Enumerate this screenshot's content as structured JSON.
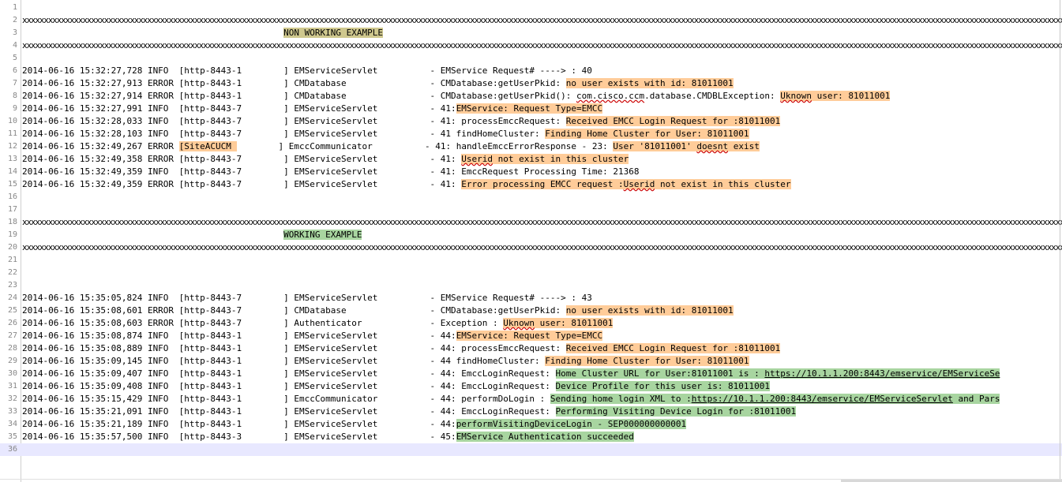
{
  "editor": {
    "lines": [
      {
        "n": "1",
        "segs": []
      },
      {
        "n": "2",
        "sep": true,
        "segs": [
          {
            "t": "xxxxxxxxxxxxxxxxxxxxxxxxxxxxxxxxxxxxxxxxxxxxxxxxxxxxxxxxxxxxxxxxxxxxxxxxxxxxxxxxxxxxxxxxxxxxxxxxxxxxxxxxxxxxxxxxxxxxxxxxxxxxxxxxxxxxxxxxxxxxxxxxxxxxxxxxxxxxxxxxxxxxxxxxxxxxxxxxxxxxxxxxxxxxxxxxxxxxxxxxxxxxxxxxxxxxxxxxxxxxxxxxxxxxxxxxxxxxxxxxxxxxxxxxxxxxxxxxxxxxxxxxxxxxxxxxxxxxxxxxxxxxxxxxxxxxxxxxxxxxxxxxxxxxxxxxxxxxxxxxxx"
          }
        ]
      },
      {
        "n": "3",
        "segs": [
          {
            "t": "                                                  "
          },
          {
            "t": "NON WORKING EXAMPLE",
            "c": "t"
          }
        ]
      },
      {
        "n": "4",
        "sep": true,
        "segs": [
          {
            "t": "xxxxxxxxxxxxxxxxxxxxxxxxxxxxxxxxxxxxxxxxxxxxxxxxxxxxxxxxxxxxxxxxxxxxxxxxxxxxxxxxxxxxxxxxxxxxxxxxxxxxxxxxxxxxxxxxxxxxxxxxxxxxxxxxxxxxxxxxxxxxxxxxxxxxxxxxxxxxxxxxxxxxxxxxxxxxxxxxxxxxxxxxxxxxxxxxxxxxxxxxxxxxxxxxxxxxxxxxxxxxxxxxxxxxxxxxxxxxxxxxxxxxxxxxxxxxxxxxxxxxxxxxxxxxxxxxxxxxxxxxxxxxxxxxxxxxxxxxxxxxxxxxxxxxxxxxxxxxxxxxx"
          }
        ]
      },
      {
        "n": "5",
        "segs": []
      },
      {
        "n": "6",
        "segs": [
          {
            "t": "2014-06-16 15:32:27,728 INFO  [http-8443-1        ] EMServiceServlet          - EMService Request# ----> : 40"
          }
        ]
      },
      {
        "n": "7",
        "segs": [
          {
            "t": "2014-06-16 15:32:27,913 ERROR [http-8443-1        ] CMDatabase                - CMDatabase:getUserPkid: "
          },
          {
            "t": "no user exists with id: 81011001",
            "c": "o"
          }
        ]
      },
      {
        "n": "8",
        "segs": [
          {
            "t": "2014-06-16 15:32:27,914 ERROR [http-8443-1        ] CMDatabase                - CMDatabase:getUserPkid(): "
          },
          {
            "t": "com.cisco.ccm",
            "c": "u"
          },
          {
            "t": ".database.CMDBLException: "
          },
          {
            "t": "Uknown",
            "c": "ou"
          },
          {
            "t": " user: 81011001",
            "c": "o"
          }
        ]
      },
      {
        "n": "9",
        "segs": [
          {
            "t": "2014-06-16 15:32:27,991 INFO  [http-8443-7        ] EMServiceServlet          - 41:"
          },
          {
            "t": "EMService: Request Type=EMCC",
            "c": "o"
          }
        ]
      },
      {
        "n": "10",
        "segs": [
          {
            "t": "2014-06-16 15:32:28,033 INFO  [http-8443-7        ] EMServiceServlet          - 41: processEmccRequest: "
          },
          {
            "t": "Received EMCC Login Request for :81011001",
            "c": "o"
          }
        ]
      },
      {
        "n": "11",
        "segs": [
          {
            "t": "2014-06-16 15:32:28,103 INFO  [http-8443-7        ] EMServiceServlet          - 41 findHomeCluster: "
          },
          {
            "t": "Finding Home Cluster for User: 81011001",
            "c": "o"
          }
        ]
      },
      {
        "n": "12",
        "segs": [
          {
            "t": "2014-06-16 15:32:49,267 ERROR "
          },
          {
            "t": "[SiteACUCM ",
            "c": "o"
          },
          {
            "t": "        ] EmccCommunicator          - 41: handleEmccErrorResponse - 23: "
          },
          {
            "t": "User '81011001' ",
            "c": "o"
          },
          {
            "t": "doesnt",
            "c": "ou"
          },
          {
            "t": " exist",
            "c": "o"
          }
        ]
      },
      {
        "n": "13",
        "segs": [
          {
            "t": "2014-06-16 15:32:49,358 ERROR [http-8443-7        ] EMServiceServlet          - 41: "
          },
          {
            "t": "Userid",
            "c": "ou"
          },
          {
            "t": " not exist in this cluster",
            "c": "o"
          }
        ]
      },
      {
        "n": "14",
        "segs": [
          {
            "t": "2014-06-16 15:32:49,359 INFO  [http-8443-7        ] EMServiceServlet          - 41: EmccRequest Processing Time: 21368"
          }
        ]
      },
      {
        "n": "15",
        "segs": [
          {
            "t": "2014-06-16 15:32:49,359 ERROR [http-8443-7        ] EMServiceServlet          - 41: "
          },
          {
            "t": "Error processing EMCC request :",
            "c": "o"
          },
          {
            "t": "Userid",
            "c": "ou"
          },
          {
            "t": " not exist in this cluster",
            "c": "o"
          }
        ]
      },
      {
        "n": "16",
        "segs": []
      },
      {
        "n": "17",
        "segs": []
      },
      {
        "n": "18",
        "sep": true,
        "segs": [
          {
            "t": "xxxxxxxxxxxxxxxxxxxxxxxxxxxxxxxxxxxxxxxxxxxxxxxxxxxxxxxxxxxxxxxxxxxxxxxxxxxxxxxxxxxxxxxxxxxxxxxxxxxxxxxxxxxxxxxxxxxxxxxxxxxxxxxxxxxxxxxxxxxxxxxxxxxxxxxxxxxxxxxxxxxxxxxxxxxxxxxxxxxxxxxxxxxxxxxxxxxxxxxxxxxxxxxxxxxxxxxxxxxxxxxxxxxxxxxxxxxxxxxxxxxxxxxxxxxxxxxxxxxxxxxxxxxxxxxxxxxxxxxxxxxxxxxxxxxxxxxxxxxxxxxxxxxxxxxxxxxxxxxxx"
          }
        ]
      },
      {
        "n": "19",
        "segs": [
          {
            "t": "                                                  "
          },
          {
            "t": "WORKING EXAMPLE",
            "c": "g"
          }
        ]
      },
      {
        "n": "20",
        "sep": true,
        "segs": [
          {
            "t": "xxxxxxxxxxxxxxxxxxxxxxxxxxxxxxxxxxxxxxxxxxxxxxxxxxxxxxxxxxxxxxxxxxxxxxxxxxxxxxxxxxxxxxxxxxxxxxxxxxxxxxxxxxxxxxxxxxxxxxxxxxxxxxxxxxxxxxxxxxxxxxxxxxxxxxxxxxxxxxxxxxxxxxxxxxxxxxxxxxxxxxxxxxxxxxxxxxxxxxxxxxxxxxxxxxxxxxxxxxxxxxxxxxxxxxxxxxxxxxxxxxxxxxxxxxxxxxxxxxxxxxxxxxxxxxxxxxxxxxxxxxxxxxxxxxxxxxxxxxxxxxxxxxxxxxxxxxxxxxxxxx"
          }
        ]
      },
      {
        "n": "21",
        "segs": []
      },
      {
        "n": "22",
        "segs": []
      },
      {
        "n": "23",
        "segs": []
      },
      {
        "n": "24",
        "segs": [
          {
            "t": "2014-06-16 15:35:05,824 INFO  [http-8443-7        ] EMServiceServlet          - EMService Request# ----> : 43"
          }
        ]
      },
      {
        "n": "25",
        "segs": [
          {
            "t": "2014-06-16 15:35:08,601 ERROR [http-8443-7        ] CMDatabase                - CMDatabase:getUserPkid: "
          },
          {
            "t": "no user exists with id: 81011001",
            "c": "o"
          }
        ]
      },
      {
        "n": "26",
        "segs": [
          {
            "t": "2014-06-16 15:35:08,603 ERROR [http-8443-7        ] Authenticator             - Exception : "
          },
          {
            "t": "Uknown",
            "c": "ou"
          },
          {
            "t": " user: 81011001",
            "c": "o"
          }
        ]
      },
      {
        "n": "27",
        "segs": [
          {
            "t": "2014-06-16 15:35:08,874 INFO  [http-8443-1        ] EMServiceServlet          - 44:"
          },
          {
            "t": "EMService: Request Type=EMCC",
            "c": "o"
          }
        ]
      },
      {
        "n": "28",
        "segs": [
          {
            "t": "2014-06-16 15:35:08,889 INFO  [http-8443-1        ] EMServiceServlet          - 44: processEmccRequest: "
          },
          {
            "t": "Received EMCC Login Request for :81011001",
            "c": "o"
          }
        ]
      },
      {
        "n": "29",
        "segs": [
          {
            "t": "2014-06-16 15:35:09,145 INFO  [http-8443-1        ] EMServiceServlet          - 44 findHomeCluster: "
          },
          {
            "t": "Finding Home Cluster for User: 81011001",
            "c": "o"
          }
        ]
      },
      {
        "n": "30",
        "segs": [
          {
            "t": "2014-06-16 15:35:09,407 INFO  [http-8443-1        ] EMServiceServlet          - 44: EmccLoginRequest: "
          },
          {
            "t": "Home Cluster URL for User:81011001 is : ",
            "c": "g"
          },
          {
            "t": "https://10.1.1.200:8443/emservice/EMServiceSe",
            "c": "gl"
          }
        ]
      },
      {
        "n": "31",
        "segs": [
          {
            "t": "2014-06-16 15:35:09,408 INFO  [http-8443-1        ] EMServiceServlet          - 44: EmccLoginRequest: "
          },
          {
            "t": "Device Profile for this user is: 81011001",
            "c": "g"
          }
        ]
      },
      {
        "n": "32",
        "segs": [
          {
            "t": "2014-06-16 15:35:15,429 INFO  [http-8443-1        ] EmccCommunicator          - 44: performDoLogin : "
          },
          {
            "t": "Sending home login XML to :",
            "c": "g"
          },
          {
            "t": "https://10.1.1.200:8443/emservice/EMServiceServlet",
            "c": "gl"
          },
          {
            "t": " and Pars",
            "c": "g"
          }
        ]
      },
      {
        "n": "33",
        "segs": [
          {
            "t": "2014-06-16 15:35:21,091 INFO  [http-8443-1        ] EMServiceServlet          - 44: EmccLoginRequest: "
          },
          {
            "t": "Performing Visiting Device Login for :81011001",
            "c": "g"
          }
        ]
      },
      {
        "n": "34",
        "segs": [
          {
            "t": "2014-06-16 15:35:21,189 INFO  [http-8443-1        ] EMServiceServlet          - 44:"
          },
          {
            "t": "performVisitingDeviceLogin - SEP000000000001",
            "c": "g"
          }
        ]
      },
      {
        "n": "35",
        "segs": [
          {
            "t": "2014-06-16 15:35:57,500 INFO  [http-8443-3        ] EMServiceServlet          - 45:"
          },
          {
            "t": "EMService Authentication succeeded",
            "c": "g"
          }
        ]
      },
      {
        "n": "36",
        "cur": true,
        "segs": []
      }
    ]
  }
}
